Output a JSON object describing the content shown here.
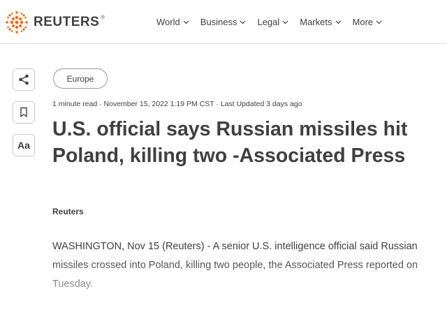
{
  "brand": {
    "name": "REUTERS",
    "registered": "®"
  },
  "nav": {
    "items": [
      {
        "label": "World"
      },
      {
        "label": "Business"
      },
      {
        "label": "Legal"
      },
      {
        "label": "Markets"
      },
      {
        "label": "More"
      }
    ]
  },
  "sidebar": {
    "font_label": "Aa"
  },
  "article": {
    "tag": "Europe",
    "meta": "1 minute read · November 15, 2022 1:19 PM CST · Last Updated 3 days ago",
    "headline": "U.S. official says Russian missiles hit Poland, killing two -Associated Press",
    "byline": "Reuters",
    "body": "WASHINGTON, Nov 15 (Reuters) - A senior U.S. intelligence official said Russian missiles crossed into Poland, killing two people, the Associated Press reported on Tuesday."
  },
  "colors": {
    "brand_orange": "#fa6400",
    "text": "#404040",
    "border": "#c8c8c8"
  },
  "icons": [
    "reuters-logo-icon",
    "chevron-down-icon",
    "share-icon",
    "bookmark-icon",
    "text-size-icon"
  ]
}
